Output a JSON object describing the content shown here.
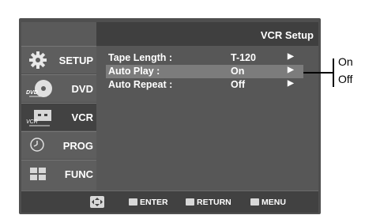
{
  "title": "VCR Setup",
  "sidebar": {
    "items": [
      {
        "label": "SETUP",
        "icon": "gear-icon"
      },
      {
        "label": "DVD",
        "icon": "dvd-icon",
        "icon_text": "DVD"
      },
      {
        "label": "VCR",
        "icon": "vcr-icon",
        "icon_text": "VCR",
        "active": true
      },
      {
        "label": "PROG",
        "icon": "clock-icon"
      },
      {
        "label": "FUNC",
        "icon": "func-icon"
      }
    ]
  },
  "settings": [
    {
      "label": "Tape Length :",
      "value": "T-120",
      "arrow": "▶"
    },
    {
      "label": "Auto Play :",
      "value": "On",
      "arrow": "▶",
      "selected": true
    },
    {
      "label": "Auto Repeat :",
      "value": "Off",
      "arrow": "▶"
    }
  ],
  "footer": {
    "enter": "ENTER",
    "return": "RETURN",
    "menu": "MENU"
  },
  "callout": {
    "options": [
      "On",
      "Off"
    ]
  },
  "colors": {
    "screen": "#4f4f4f",
    "selected_row": "#7c7c7c",
    "text": "#ffffff"
  }
}
